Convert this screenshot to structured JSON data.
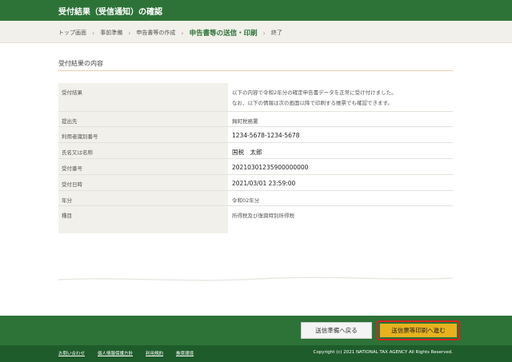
{
  "header": {
    "title": "受付結果（受信通知）の確認"
  },
  "breadcrumb": {
    "items": [
      "トップ画面",
      "事前準備",
      "申告書等の作成",
      "申告書等の送信・印刷",
      "終了"
    ],
    "separator": "›"
  },
  "section": {
    "title": "受付結果の内容"
  },
  "table": {
    "rows": [
      {
        "label": "受付結果",
        "value_line1": "以下の内容で令和2年分の確定申告書データを正常に受け付けました。",
        "value_line2": "なお、以下の情報は次の画面以降で印刷する帳票でも確認できます。"
      },
      {
        "label": "提出先",
        "value": "麹町税務署"
      },
      {
        "label": "利用者識別番号",
        "value": "1234-5678-1234-5678"
      },
      {
        "label": "氏名又は名称",
        "value": "国税　太郎"
      },
      {
        "label": "受付番号",
        "value": "20210301235900000000"
      },
      {
        "label": "受付日時",
        "value": "2021/03/01 23:59:00"
      },
      {
        "label": "年分",
        "value": "令和02年分"
      },
      {
        "label": "種目",
        "value": "所得税及び復興特別所得税"
      }
    ]
  },
  "actions": {
    "back_label": "送信準備へ戻る",
    "next_label": "送信票等印刷へ進む"
  },
  "footer": {
    "links": [
      "お問い合わせ",
      "個人情報保護方針",
      "利用規約",
      "推奨環境"
    ],
    "copyright": "Copyright (c) 2021 NATIONAL TAX AGENCY All Rights Reserved."
  },
  "colors": {
    "brand_green": "#2d7338",
    "accent_gold": "#e8b21f",
    "highlight_red": "#d9221c"
  }
}
